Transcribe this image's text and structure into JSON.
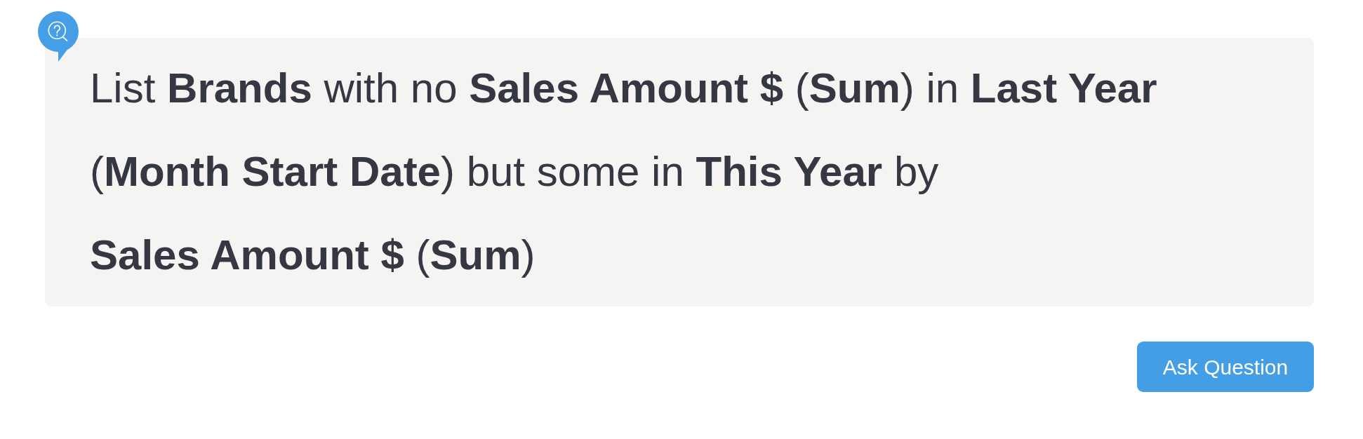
{
  "question": {
    "text": "List **Brands** with no **Sales Amount $** (**Sum**) in **Last Year** (**Month Start Date**) but some in **This Year** by **Sales Amount $** (**Sum**)"
  },
  "ask_button": {
    "label": "Ask Question"
  }
}
